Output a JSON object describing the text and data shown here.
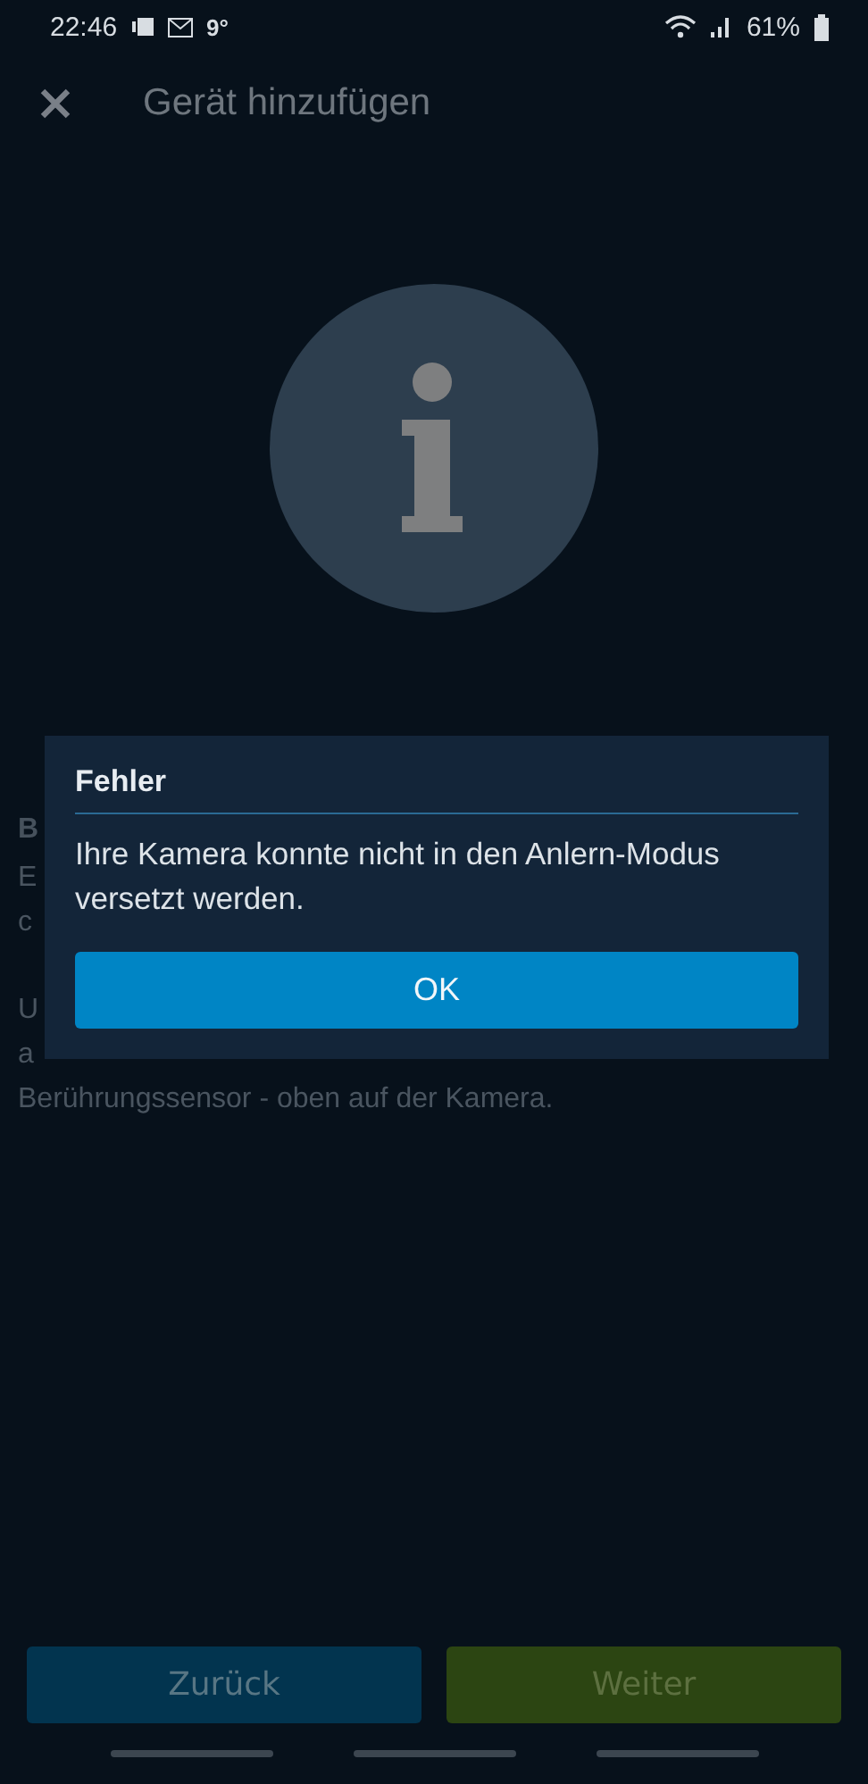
{
  "status_bar": {
    "time": "22:46",
    "temperature": "9°",
    "battery": "61%"
  },
  "header": {
    "title": "Gerät hinzufügen"
  },
  "background_text": {
    "heading": "B",
    "paragraphs": [
      [
        "E",
        "c"
      ],
      [
        "U",
        "a",
        "Berührungssensor - oben auf der Kamera."
      ]
    ]
  },
  "dialog": {
    "title": "Fehler",
    "message": "Ihre Kamera konnte nicht in den Anlern-Modus versetzt werden.",
    "button": "OK"
  },
  "footer_buttons": [
    {
      "label": "Zurück",
      "kind": "back"
    },
    {
      "label": "Weiter",
      "kind": "next"
    }
  ]
}
